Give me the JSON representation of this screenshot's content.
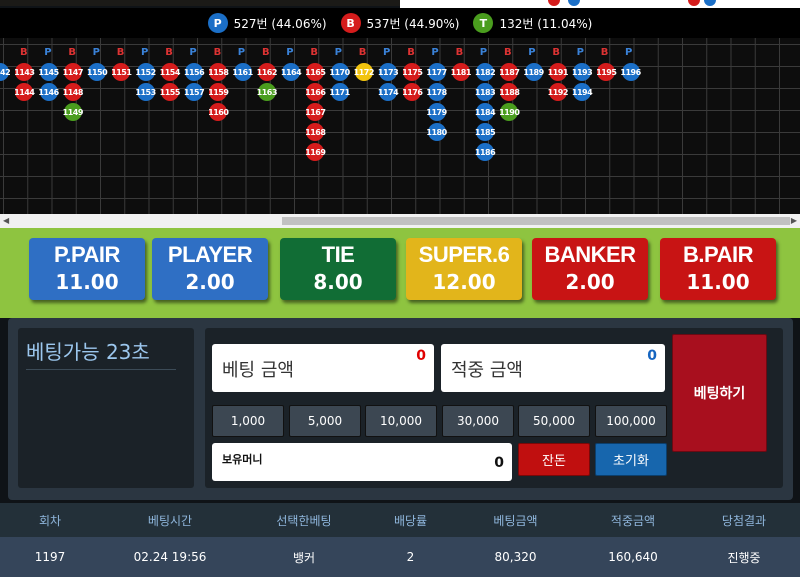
{
  "stats": {
    "player": {
      "badge": "P",
      "label": "527번 (44.06%)",
      "color": "#1b6fc7"
    },
    "banker": {
      "badge": "B",
      "label": "537번 (44.90%)",
      "color": "#d51c1c"
    },
    "tie": {
      "badge": "T",
      "label": "132번 (11.04%)",
      "color": "#4a9d1e"
    }
  },
  "road": {
    "header": [
      "B",
      "P",
      "B",
      "P",
      "B",
      "P",
      "B",
      "P",
      "B",
      "P",
      "B",
      "P",
      "B",
      "P",
      "B",
      "P",
      "B",
      "P",
      "B",
      "P",
      "B",
      "P",
      "B",
      "P",
      "B",
      "P"
    ],
    "columns": [
      {
        "c": "P",
        "n": [
          "1142"
        ]
      },
      {
        "c": "B",
        "n": [
          "1143",
          "1144"
        ]
      },
      {
        "c": "P",
        "n": [
          "1145",
          "1146"
        ]
      },
      {
        "c": "B",
        "n": [
          "1147",
          "1148"
        ]
      },
      {
        "c": "P",
        "n": [
          "1150"
        ]
      },
      {
        "c": "B",
        "n": [
          "1151"
        ]
      },
      {
        "c": "P",
        "n": [
          "1152",
          "1153"
        ]
      },
      {
        "c": "B",
        "n": [
          "1154",
          "1155"
        ]
      },
      {
        "c": "P",
        "n": [
          "1156",
          "1157"
        ]
      },
      {
        "c": "B",
        "n": [
          "1158",
          "1159",
          "1160"
        ]
      },
      {
        "c": "P",
        "n": [
          "1161"
        ]
      },
      {
        "c": "B",
        "n": [
          "1162"
        ]
      },
      {
        "c": "P",
        "n": [
          "1164"
        ]
      },
      {
        "c": "B",
        "n": [
          "1165",
          "1166",
          "1167",
          "1168",
          "1169"
        ]
      },
      {
        "c": "P",
        "n": [
          "1170",
          "1171"
        ]
      },
      {
        "c": "B",
        "n": [
          "1172"
        ]
      },
      {
        "c": "P",
        "n": [
          "1173",
          "1174"
        ]
      },
      {
        "c": "B",
        "n": [
          "1175",
          "1176"
        ]
      },
      {
        "c": "P",
        "n": [
          "1177",
          "1178",
          "1179",
          "1180"
        ]
      },
      {
        "c": "B",
        "n": [
          "1181"
        ]
      },
      {
        "c": "P",
        "n": [
          "1182",
          "1183",
          "1184",
          "1185",
          "1186"
        ]
      },
      {
        "c": "B",
        "n": [
          "1187",
          "1188"
        ]
      },
      {
        "c": "P",
        "n": [
          "1189"
        ]
      },
      {
        "c": "B",
        "n": [
          "1191",
          "1192"
        ]
      },
      {
        "c": "P",
        "n": [
          "1193",
          "1194"
        ]
      },
      {
        "c": "B",
        "n": [
          "1195"
        ]
      },
      {
        "c": "P",
        "n": [
          "1196"
        ]
      }
    ],
    "ties": [
      "1149",
      "1163",
      "1190"
    ],
    "highlight": "1172"
  },
  "bets": [
    {
      "name": "P.PAIR",
      "odds": "11.00",
      "color": "#2f6fc4",
      "textcolor": "#ffffff"
    },
    {
      "name": "PLAYER",
      "odds": "2.00",
      "color": "#2f6fc4",
      "textcolor": "#ffffff"
    },
    {
      "name": "TIE",
      "odds": "8.00",
      "color": "#116d35",
      "textcolor": "#ffffff"
    },
    {
      "name": "SUPER.6",
      "odds": "12.00",
      "color": "#e2b51b",
      "textcolor": "#ffffff"
    },
    {
      "name": "BANKER",
      "odds": "2.00",
      "color": "#c81414",
      "textcolor": "#ffffff"
    },
    {
      "name": "B.PAIR",
      "odds": "11.00",
      "color": "#c81414",
      "textcolor": "#ffffff"
    }
  ],
  "panel": {
    "timer": "베팅가능 23초",
    "bet_amount_label": "베팅 금액",
    "bet_amount_value": "0",
    "win_amount_label": "적중 금액",
    "win_amount_value": "0",
    "chips": [
      "1,000",
      "5,000",
      "10,000",
      "30,000",
      "50,000",
      "100,000"
    ],
    "holding_label": "보유머니",
    "holding_value": "0",
    "change_btn": "잔돈",
    "reset_btn": "초기화",
    "place_btn": "베팅하기"
  },
  "history": {
    "headers": [
      "회차",
      "베팅시간",
      "선택한베팅",
      "배당률",
      "베팅금액",
      "적중금액",
      "당첨결과"
    ],
    "rows": [
      [
        "1197",
        "02.24 19:56",
        "뱅커",
        "2",
        "80,320",
        "160,640",
        "진행중"
      ]
    ]
  }
}
